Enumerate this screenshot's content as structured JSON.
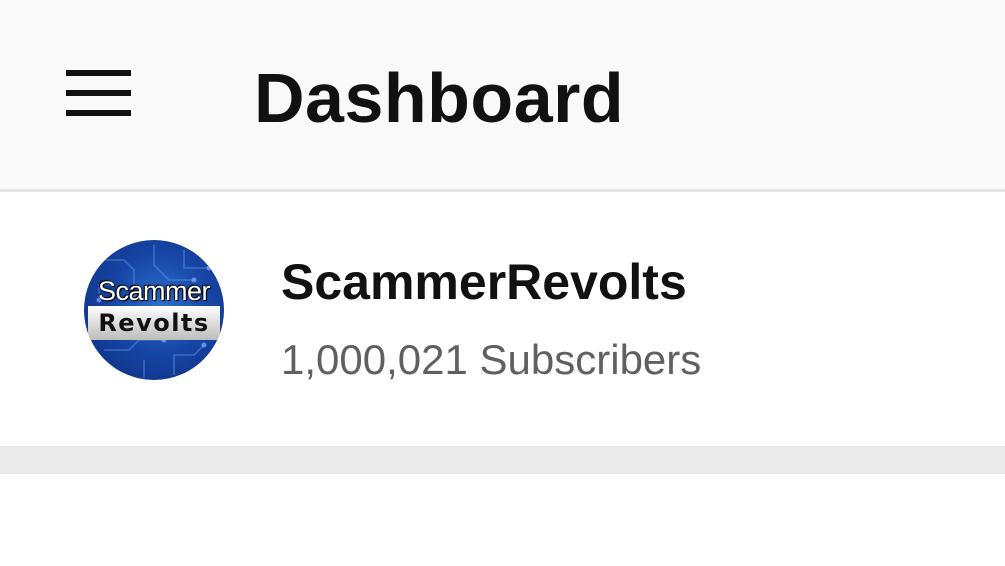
{
  "header": {
    "title": "Dashboard",
    "menu_icon": "hamburger-menu-icon"
  },
  "channel": {
    "name": "ScammerRevolts",
    "subscribers": "1,000,021 Subscribers",
    "avatar": {
      "logo_text_top": "Scammer",
      "logo_text_bottom": "Revolts",
      "background_color": "#1746a6"
    }
  },
  "colors": {
    "toolbar_bg": "#f9f9f9",
    "divider": "#ebebeb",
    "primary_text": "#111111",
    "secondary_text": "#606060"
  }
}
